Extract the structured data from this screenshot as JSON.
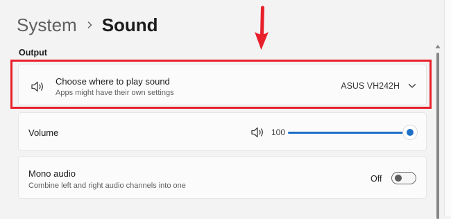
{
  "breadcrumb": {
    "parent": "System",
    "current": "Sound"
  },
  "output": {
    "section_title": "Output",
    "choose_device": {
      "title": "Choose where to play sound",
      "subtitle": "Apps might have their own settings",
      "selected_device": "ASUS VH242H"
    },
    "volume": {
      "label": "Volume",
      "value": "100",
      "level": 1.0
    },
    "mono_audio": {
      "title": "Mono audio",
      "subtitle": "Combine left and right audio channels into one",
      "state": "Off",
      "enabled": false
    }
  },
  "icons": {
    "breadcrumb_separator": "chevron-right-icon",
    "device": "speaker-icon",
    "dropdown": "chevron-down-icon",
    "volume": "speaker-icon"
  },
  "colors": {
    "background": "#f3f3f3",
    "card": "#fbfbfb",
    "accent": "#1f6fc5",
    "annotation": "#e8202b"
  }
}
